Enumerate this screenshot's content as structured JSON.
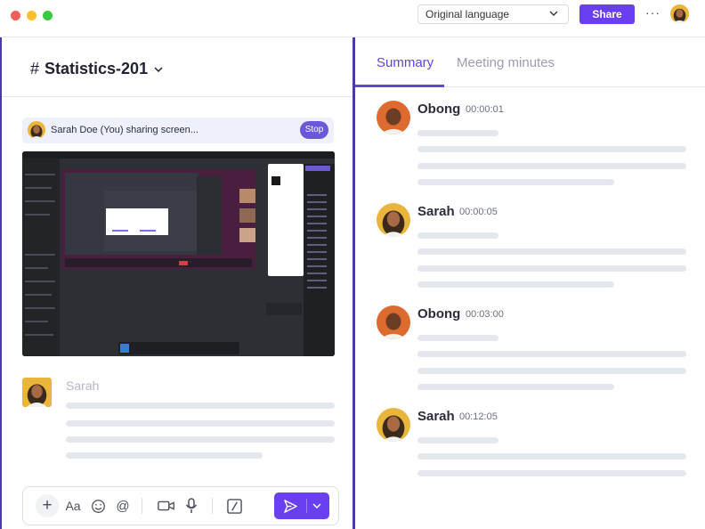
{
  "header": {
    "language_select": "Original language",
    "share_label": "Share",
    "more_label": "···"
  },
  "channel": {
    "hash": "#",
    "name": "Statistics-201"
  },
  "screen_share": {
    "banner_text": "Sarah Doe (You) sharing screen...",
    "stop_label": "Stop"
  },
  "message": {
    "author": "Sarah"
  },
  "tabs": [
    {
      "label": "Summary",
      "active": true
    },
    {
      "label": "Meeting minutes",
      "active": false
    }
  ],
  "entries": [
    {
      "name": "Obong",
      "time": "00:00:01",
      "person": "obong"
    },
    {
      "name": "Sarah",
      "time": "00:00:05",
      "person": "sarah"
    },
    {
      "name": "Obong",
      "time": "00:03:00",
      "person": "obong"
    },
    {
      "name": "Sarah",
      "time": "00:12:05",
      "person": "sarah"
    }
  ],
  "composer": {
    "icons": [
      "plus-icon",
      "text-format-icon",
      "emoji-icon",
      "mention-icon",
      "video-icon",
      "microphone-icon",
      "slash-command-icon",
      "send-icon",
      "chevron-down-icon"
    ]
  },
  "colors": {
    "accent": "#6a3ff0",
    "tab_active": "#5b47d6",
    "divider": "#4b3aa3"
  }
}
